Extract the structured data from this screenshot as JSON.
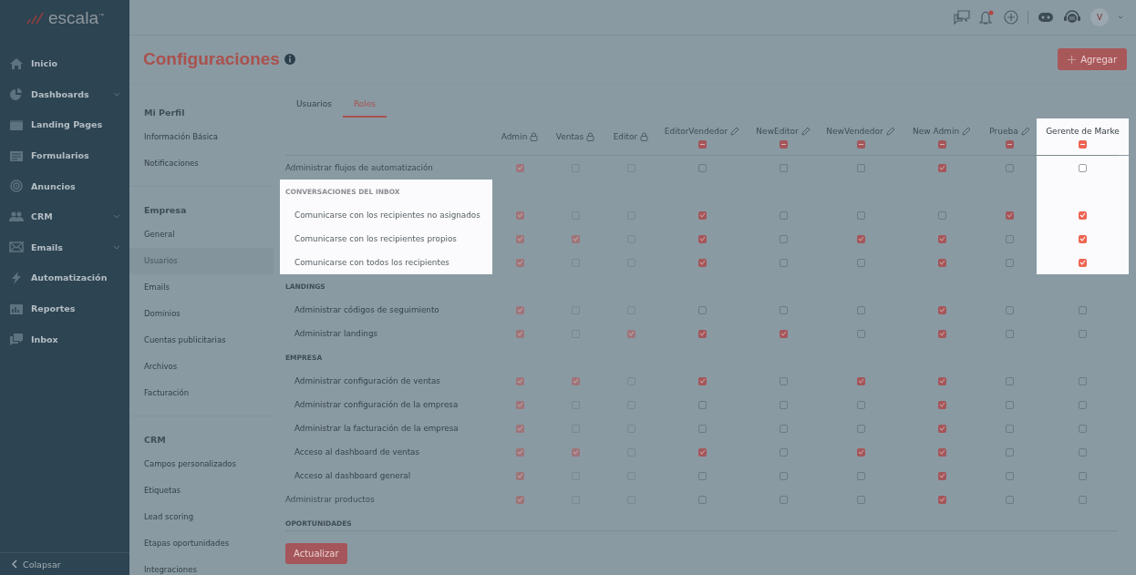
{
  "brand": {
    "logo": "escala$^{™}$"
  },
  "sidebar": {
    "items": [
      {
        "label": "Inicio",
        "expandable": false
      },
      {
        "label": "Dashboards",
        "expandable": true
      },
      {
        "label": "Landing Pages",
        "expandable": false
      },
      {
        "label": "Formularios",
        "expandable": false
      },
      {
        "label": "Anuncios",
        "expandable": false
      },
      {
        "label": "CRM",
        "expandable": true
      },
      {
        "label": "Emails",
        "expandable": true
      },
      {
        "label": "Automatización",
        "expandable": false
      },
      {
        "label": "Reportes",
        "expandable": false
      },
      {
        "label": "Inbox",
        "expandable": false
      }
    ],
    "collapse": "Colapsar"
  },
  "topbar": {
    "avatar": "V",
    "notification_dot": true
  },
  "page": {
    "title": "Configuraciones",
    "add_button": "Agregar"
  },
  "settings_nav": [
    {
      "title": "Mi Perfil",
      "items": [
        {
          "label": "Información Básica",
          "selected": false
        },
        {
          "label": "Notificaciones",
          "selected": false
        }
      ]
    },
    {
      "title": "Empresa",
      "items": [
        {
          "label": "General",
          "selected": false
        },
        {
          "label": "Usuarios",
          "selected": true
        },
        {
          "label": "Emails",
          "selected": false
        },
        {
          "label": "Dominios",
          "selected": false
        },
        {
          "label": "Cuentas publicitarias",
          "selected": false
        },
        {
          "label": "Archivos",
          "selected": false
        },
        {
          "label": "Facturación",
          "selected": false
        }
      ]
    },
    {
      "title": "CRM",
      "items": [
        {
          "label": "Campos personalizados",
          "selected": false
        },
        {
          "label": "Etiquetas",
          "selected": false
        },
        {
          "label": "Lead scoring",
          "selected": false
        },
        {
          "label": "Etapas oportunidades",
          "selected": false
        },
        {
          "label": "Integraciones",
          "selected": false
        }
      ]
    }
  ],
  "tabs": [
    {
      "label": "Usuarios",
      "selected": false
    },
    {
      "label": "Roles",
      "selected": true
    }
  ],
  "roles": [
    {
      "name": "Admin",
      "locked": true,
      "spotlight": false
    },
    {
      "name": "Ventas",
      "locked": true,
      "spotlight": false
    },
    {
      "name": "Editor",
      "locked": true,
      "spotlight": false
    },
    {
      "name": "EditorVendedor",
      "locked": false,
      "indeterminate": true,
      "spotlight": false
    },
    {
      "name": "NewEditor",
      "locked": false,
      "indeterminate": true,
      "spotlight": false
    },
    {
      "name": "NewVendedor",
      "locked": false,
      "indeterminate": true,
      "spotlight": false
    },
    {
      "name": "New Admin",
      "locked": false,
      "indeterminate": true,
      "spotlight": false
    },
    {
      "name": "Prueba",
      "locked": false,
      "indeterminate": true,
      "spotlight": false
    },
    {
      "name": "Gerente de Marke",
      "locked": false,
      "indeterminate": true,
      "spotlight": true
    }
  ],
  "permissions": [
    {
      "kind": "item",
      "label": "Administrar flujos de automatización",
      "checked": [
        true,
        false,
        false,
        false,
        false,
        false,
        true,
        false,
        false
      ]
    },
    {
      "kind": "group",
      "title": "CONVERSACIONES DEL INBOX",
      "spotlight": true,
      "items": [
        {
          "label": "Comunicarse con los recipientes no asignados",
          "checked": [
            true,
            false,
            false,
            true,
            false,
            false,
            false,
            true,
            true
          ]
        },
        {
          "label": "Comunicarse con los recipientes propios",
          "checked": [
            true,
            true,
            false,
            true,
            false,
            true,
            true,
            false,
            true
          ]
        },
        {
          "label": "Comunicarse con todos los recipientes",
          "checked": [
            true,
            false,
            false,
            true,
            false,
            false,
            true,
            false,
            true
          ]
        }
      ]
    },
    {
      "kind": "group",
      "title": "LANDINGS",
      "spotlight": false,
      "items": [
        {
          "label": "Administrar códigos de seguimiento",
          "checked": [
            true,
            false,
            false,
            false,
            false,
            false,
            true,
            false,
            false
          ]
        },
        {
          "label": "Administrar landings",
          "checked": [
            true,
            false,
            true,
            true,
            true,
            false,
            true,
            false,
            false
          ]
        }
      ]
    },
    {
      "kind": "group",
      "title": "EMPRESA",
      "spotlight": false,
      "items": [
        {
          "label": "Administrar configuración de ventas",
          "checked": [
            true,
            true,
            false,
            true,
            false,
            true,
            true,
            false,
            false
          ]
        },
        {
          "label": "Administrar configuración de la empresa",
          "checked": [
            true,
            false,
            false,
            false,
            false,
            false,
            true,
            false,
            false
          ]
        },
        {
          "label": "Administrar la facturación de la empresa",
          "checked": [
            true,
            false,
            false,
            false,
            false,
            false,
            true,
            false,
            false
          ]
        },
        {
          "label": "Acceso al dashboard de ventas",
          "checked": [
            true,
            true,
            false,
            true,
            false,
            true,
            true,
            false,
            false
          ]
        },
        {
          "label": "Acceso al dashboard general",
          "checked": [
            true,
            false,
            false,
            false,
            false,
            false,
            true,
            false,
            false
          ]
        }
      ]
    },
    {
      "kind": "item",
      "label": "Administrar productos",
      "checked": [
        true,
        false,
        false,
        false,
        false,
        false,
        true,
        false,
        false
      ]
    },
    {
      "kind": "group",
      "title": "OPORTUNIDADES",
      "spotlight": false
    }
  ],
  "update_button": "Actualizar"
}
